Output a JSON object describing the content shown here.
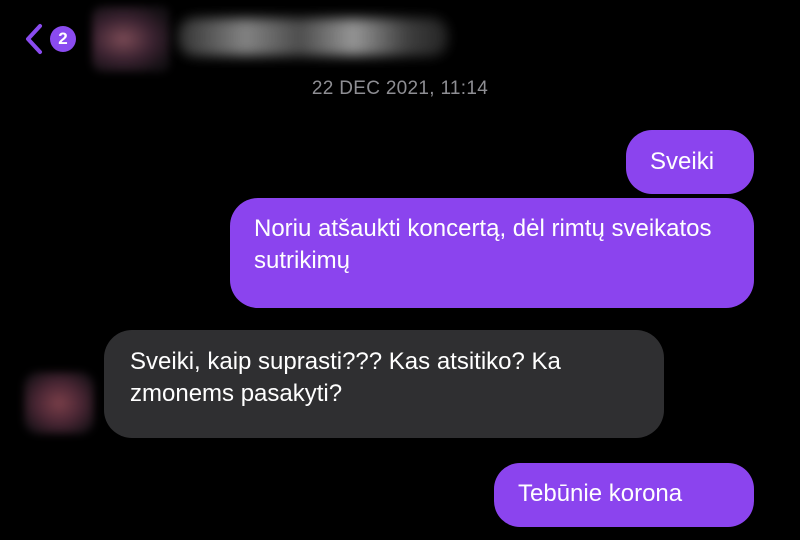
{
  "header": {
    "back_badge_count": "2",
    "back_icon": "chevron-left-icon"
  },
  "timestamp": "22 DEC 2021, 11:14",
  "messages": [
    {
      "direction": "outgoing",
      "text": "Sveiki"
    },
    {
      "direction": "outgoing",
      "text": "Noriu atšaukti koncertą, dėl rimtų sveikatos sutrikimų"
    },
    {
      "direction": "incoming",
      "text": "Sveiki, kaip suprasti??? Kas atsitiko? Ka zmonems pasakyti?"
    },
    {
      "direction": "outgoing",
      "text": "Tebūnie korona"
    }
  ],
  "colors": {
    "background": "#000000",
    "outgoing_bubble": "#8b44ee",
    "incoming_bubble": "#2f2f31",
    "accent": "#8a4bf0",
    "timestamp": "#8e8e93"
  }
}
